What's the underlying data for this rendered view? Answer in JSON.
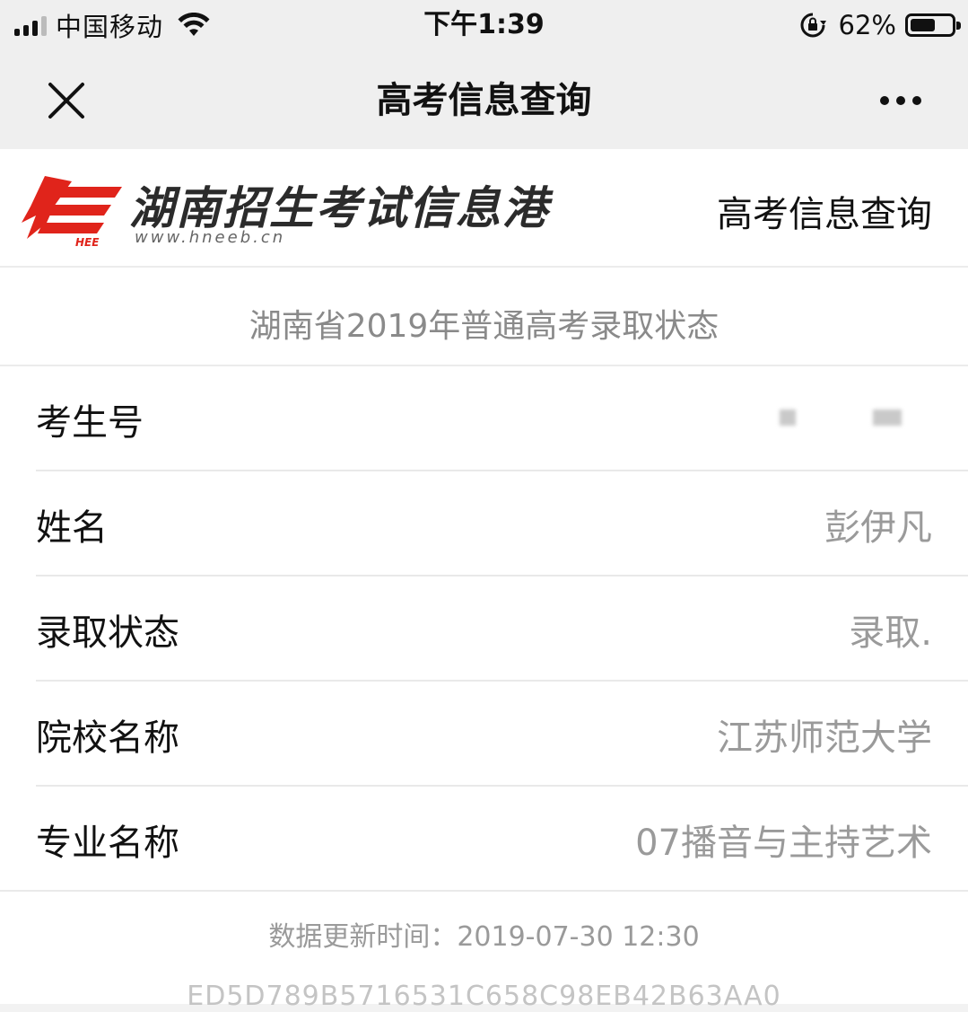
{
  "status_bar": {
    "carrier": "中国移动",
    "time": "下午1:39",
    "battery_percent": "62%",
    "battery_level": 0.62
  },
  "nav": {
    "title": "高考信息查询"
  },
  "header": {
    "logo_badge": "HEE",
    "logo_title": "湖南招生考试信息港",
    "logo_url": "www.hneeb.cn",
    "link": "高考信息查询"
  },
  "main": {
    "section_title": "湖南省2019年普通高考录取状态",
    "rows": [
      {
        "label": "考生号",
        "value": ""
      },
      {
        "label": "姓名",
        "value": "彭伊凡"
      },
      {
        "label": "录取状态",
        "value": "录取."
      },
      {
        "label": "院校名称",
        "value": "江苏师范大学"
      },
      {
        "label": "专业名称",
        "value": "07播音与主持艺术"
      }
    ],
    "update_time": "数据更新时间：2019-07-30 12:30",
    "hash": "ED5D789B5716531C658C98EB42B63AA0"
  },
  "colors": {
    "logo_red": "#e0241b",
    "value_gray": "#9a9a9a"
  }
}
